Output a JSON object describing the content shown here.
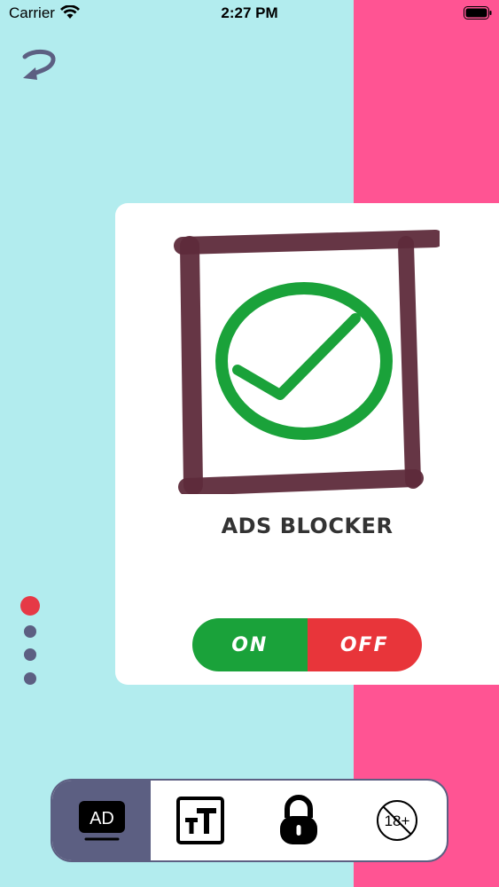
{
  "status_bar": {
    "carrier": "Carrier",
    "time": "2:27 PM"
  },
  "card": {
    "title": "ADS BLOCKER",
    "toggle": {
      "on_label": "ON",
      "off_label": "OFF"
    }
  },
  "pager": {
    "count": 4,
    "active_index": 0
  },
  "tab_bar": {
    "tabs": [
      {
        "icon": "ad-monitor-icon",
        "label": "AD",
        "active": true
      },
      {
        "icon": "text-size-icon",
        "active": false
      },
      {
        "icon": "lock-icon",
        "active": false
      },
      {
        "icon": "adult-content-blocked-icon",
        "label": "18+",
        "active": false
      }
    ]
  },
  "colors": {
    "background": "#b2ecee",
    "accent_strip": "#ff5493",
    "on": "#1aa23a",
    "off": "#e8353a",
    "nav_active": "#5c5f82",
    "checkmark": "#1aa23a",
    "frame": "#5e2b3b"
  }
}
